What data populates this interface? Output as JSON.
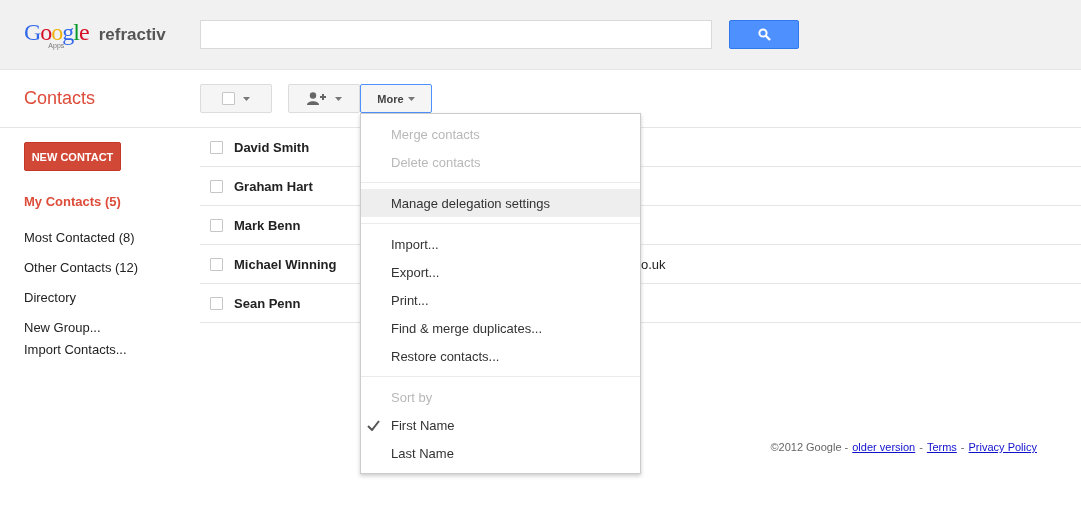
{
  "header": {
    "logo": {
      "brand": "Google",
      "sub": "Apps",
      "partner": "refractiv"
    }
  },
  "app_title": "Contacts",
  "toolbar": {
    "select_checked": false,
    "more_label": "More",
    "more_open": true
  },
  "sidebar": {
    "new_button": "NEW CONTACT",
    "items": [
      {
        "label": "My Contacts (5)",
        "selected": true
      },
      {
        "label": "Most Contacted (8)",
        "selected": false
      },
      {
        "label": "Other Contacts (12)",
        "selected": false
      },
      {
        "label": "Directory",
        "selected": false
      }
    ],
    "links": [
      "New Group...",
      "Import Contacts..."
    ]
  },
  "contacts": [
    {
      "name": "David Smith",
      "checked": false
    },
    {
      "name": "Graham Hart",
      "checked": false
    },
    {
      "name": "Mark Benn",
      "checked": false
    },
    {
      "name": "Michael Winning",
      "checked": false,
      "column_2": "o.uk"
    },
    {
      "name": "Sean Penn",
      "checked": false
    }
  ],
  "menu": [
    {
      "kind": "item",
      "label": "Merge contacts",
      "disabled": true,
      "selected": false,
      "checked": false
    },
    {
      "kind": "item",
      "label": "Delete contacts",
      "disabled": true,
      "selected": false,
      "checked": false
    },
    {
      "kind": "separator"
    },
    {
      "kind": "item",
      "label": "Manage delegation settings",
      "disabled": false,
      "selected": true,
      "checked": false
    },
    {
      "kind": "separator"
    },
    {
      "kind": "item",
      "label": "Import...",
      "disabled": false,
      "selected": false,
      "checked": false
    },
    {
      "kind": "item",
      "label": "Export...",
      "disabled": false,
      "selected": false,
      "checked": false
    },
    {
      "kind": "item",
      "label": "Print...",
      "disabled": false,
      "selected": false,
      "checked": false
    },
    {
      "kind": "item",
      "label": "Find & merge duplicates...",
      "disabled": false,
      "selected": false,
      "checked": false
    },
    {
      "kind": "item",
      "label": "Restore contacts...",
      "disabled": false,
      "selected": false,
      "checked": false
    },
    {
      "kind": "separator"
    },
    {
      "kind": "item",
      "label": "Sort by",
      "disabled": true,
      "selected": false,
      "checked": false
    },
    {
      "kind": "item",
      "label": "First Name",
      "disabled": false,
      "selected": false,
      "checked": true
    },
    {
      "kind": "item",
      "label": "Last Name",
      "disabled": false,
      "selected": false,
      "checked": false
    }
  ],
  "footer": {
    "copyright": "©2012 Google -",
    "links": [
      {
        "label": "older version"
      },
      {
        "label": "Terms"
      },
      {
        "label": "Privacy Policy"
      }
    ],
    "separator": "-"
  }
}
